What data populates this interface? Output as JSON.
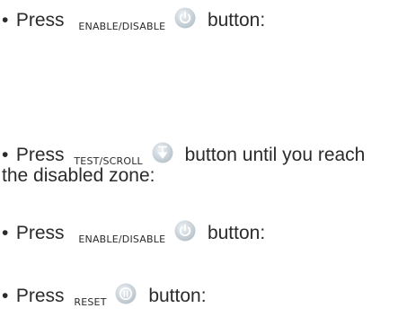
{
  "steps": [
    {
      "bullet": "•",
      "verb": "Press",
      "key_label": "ENABLE/DISABLE",
      "icon": "power-icon",
      "suffix": "button:"
    },
    {
      "bullet": "•",
      "verb": "Press",
      "key_label": "TEST/SCROLL",
      "icon": "scroll-arrow-icon",
      "suffix": "button until you reach",
      "continuation": "the disabled zone:"
    },
    {
      "bullet": "•",
      "verb": "Press",
      "key_label": "ENABLE/DISABLE",
      "icon": "power-icon",
      "suffix": "button:"
    },
    {
      "bullet": "•",
      "verb": "Press",
      "key_label": "RESET",
      "icon": "reset-icon",
      "suffix": "button:"
    }
  ],
  "colors": {
    "text": "#2b2b2b",
    "button_face": "#c9d2d9",
    "button_light": "#eef2f5",
    "button_symbol": "#ffffff"
  }
}
